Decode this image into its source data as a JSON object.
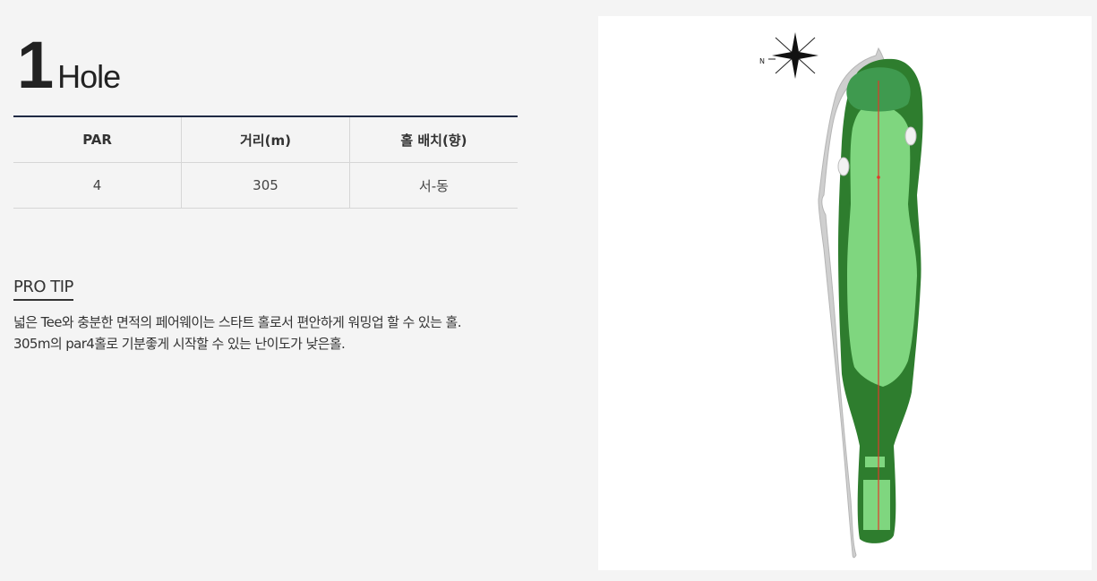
{
  "hole": {
    "number": "1",
    "word": "Hole"
  },
  "table": {
    "headers": [
      "PAR",
      "거리(m)",
      "홀 배치(향)"
    ],
    "row": [
      "4",
      "305",
      "서-동"
    ]
  },
  "pro_tip": {
    "label": "PRO TIP",
    "lines": [
      "넓은 Tee와 충분한 면적의 페어웨이는 스타트 홀로서 편안하게 워밍업 할 수 있는 홀.",
      "305m의 par4홀로 기분좋게 시작할 수 있는 난이도가 낮은홀."
    ]
  },
  "map": {
    "compass_letter": "N",
    "colors": {
      "rough": "#2e7d2e",
      "fairway": "#7fd67f",
      "green": "#3f9a4f",
      "path": "#c8c8c8",
      "line": "#e03a2a"
    }
  }
}
